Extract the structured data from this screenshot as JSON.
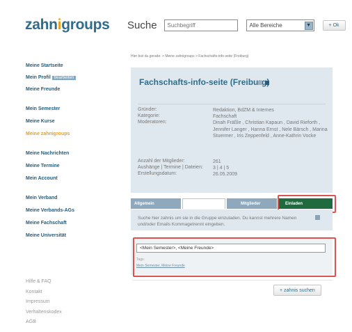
{
  "logo": {
    "part1": "zahn",
    "dot": "i",
    "part2": "groups"
  },
  "search": {
    "label": "Suche",
    "placeholder": "Suchbegriff",
    "scope": "Alle Bereiche",
    "button": "+ Ok"
  },
  "breadcrumb": "Hier bist du gerade: > Meine zahnigroups > Fachschafts-info-seite (Freiburg)",
  "sidebar": {
    "group1": [
      {
        "label": "Meine Startseite"
      },
      {
        "label": "Mein Profil",
        "badge": "bearbeiten"
      },
      {
        "label": "Meine Freunde"
      }
    ],
    "group2": [
      {
        "label": "Mein Semester"
      },
      {
        "label": "Meine Kurse"
      },
      {
        "label": "Meine zahnigroups"
      }
    ],
    "group3": [
      {
        "label": "Meine Nachrichten"
      },
      {
        "label": "Meine Termine"
      },
      {
        "label": "Mein Account"
      }
    ],
    "group4": [
      {
        "label": "Mein Verband"
      },
      {
        "label": "Meine Verbands-AGs"
      },
      {
        "label": "Meine Fachschaft"
      },
      {
        "label": "Meine Universität"
      }
    ],
    "footer": [
      "Hilfe & FAQ",
      "Kontakt",
      "Impressum",
      "Verhaltenskodex",
      "AGB"
    ]
  },
  "group": {
    "title": "Fachschafts-info-seite (Freiburg)",
    "labels": {
      "founder": "Gründer:",
      "category": "Kategorie:",
      "moderators": "Moderatoren:",
      "members": "Anzahl der Mitglieder:",
      "postings": "Aushänge | Termine | Dateien:",
      "created": "Erstellungsdatum:"
    },
    "values": {
      "founder": "Redaktion, BdZM & Internes",
      "category": "Fachschaft",
      "moderators": "Dinah Fräßle , Christian Kapaun , David Rieforth , Jennifer Langer , Hanna Ernst , Nele Bärsch , Marina Stuermer , Iris Zeppenfeld , Anne-Kathrin Vocke",
      "members": "261",
      "postings": "3 | 4 | 5",
      "created": "26.05.2009"
    }
  },
  "tabs": {
    "general": "Allgemein",
    "members": "Mitglieder",
    "invite": "Einladen"
  },
  "invite": {
    "hint": "Suche hier zahnis um sie in die Gruppe einzuladen. Du kannst mehrere Namen und/oder Emails Kommagetrennt eingeben.",
    "input_value": "<Mein Semester>, <Meine Freunde>",
    "tags_label": "Tags:",
    "tag_links": "Mein Semester, Meine Freunde"
  },
  "search_users_button": "+ zahnis suchen",
  "colors": {
    "brand": "#2f6d8a",
    "accent": "#e8a020",
    "invite_tab": "#1f6b3f",
    "highlight": "#d9534f"
  }
}
